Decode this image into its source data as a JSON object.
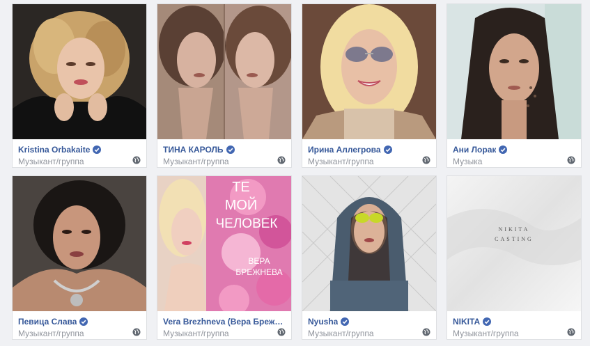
{
  "pages": [
    {
      "name": "Kristina Orbakaite",
      "category": "Музыкант/группа",
      "verified": true,
      "image": "portrait-blonde-curly-hands-on-chin"
    },
    {
      "name": "ТИНА КАРОЛЬ",
      "category": "Музыкант/группа",
      "verified": true,
      "image": "split-portrait-sepia"
    },
    {
      "name": "Ирина Аллегрова",
      "category": "Музыкант/группа",
      "verified": true,
      "image": "portrait-blonde-sunglasses"
    },
    {
      "name": "Ани Лорак",
      "category": "Музыка",
      "verified": true,
      "image": "portrait-wet-hair-teal-background"
    },
    {
      "name": "Певица Слава",
      "category": "Музыкант/группа",
      "verified": true,
      "image": "portrait-dark-hair-necklace"
    },
    {
      "name": "Vera Brezhneva (Вера Брежнева)",
      "category": "Музыкант/группа",
      "verified": false,
      "image": "album-cover-pink-flowers"
    },
    {
      "name": "Nyusha",
      "category": "Музыкант/группа",
      "verified": true,
      "image": "portrait-hoodie-yellow-glasses"
    },
    {
      "name": "NIKITA",
      "category": "Музыкант/группа",
      "verified": true,
      "image": "casting-poster-white"
    }
  ],
  "cover_texts": {
    "vera_line1": "ТЕ",
    "vera_line2": "МОЙ",
    "vera_line3": "ЧЕЛОВЕК",
    "vera_line4": "ВЕРА",
    "vera_line5": "БРЕЖНЕВА",
    "nikita_line1": "NIKITA",
    "nikita_line2": "CASTING"
  },
  "colors": {
    "link": "#365899",
    "verified": "#4267b2",
    "muted": "#90949c"
  }
}
